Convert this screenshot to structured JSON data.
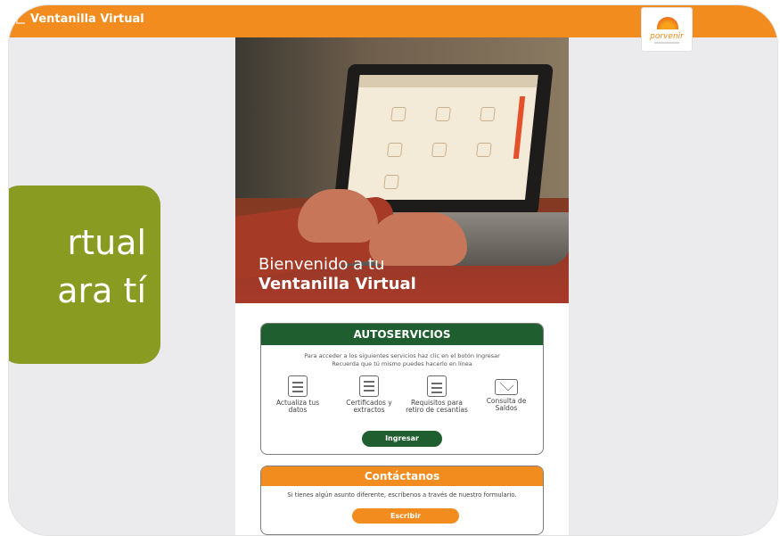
{
  "header": {
    "title": "Ventanilla Virtual",
    "logo_text": "porvenir",
    "color": "#f28c1e"
  },
  "promo": {
    "line1": "rtual",
    "line2": "ara tí",
    "color": "#8a9b22"
  },
  "hero": {
    "welcome_line1": "Bienvenido a tu",
    "welcome_line2": "Ventanilla Virtual"
  },
  "autoservicios": {
    "title": "AUTOSERVICIOS",
    "intro_line1": "Para acceder a los siguientes servicios haz clic en el botón Ingresar",
    "intro_line2": "Recuerda que tú mismo puedes hacerlo en línea",
    "services": [
      {
        "label": "Actualiza tus datos",
        "icon": "update-data-icon"
      },
      {
        "label": "Certificados y extractos",
        "icon": "certificate-icon"
      },
      {
        "label": "Requisitos para retiro de cesantías",
        "icon": "document-icon"
      },
      {
        "label": "Consulta de Saldos",
        "icon": "envelope-icon"
      }
    ],
    "button_label": "Ingresar",
    "color": "#1f5e2e"
  },
  "contact": {
    "title": "Contáctanos",
    "text": "Si tienes algún asunto diferente, escríbenos a través de nuestro formulario.",
    "button_label": "Escribir",
    "color": "#f28c1e"
  }
}
